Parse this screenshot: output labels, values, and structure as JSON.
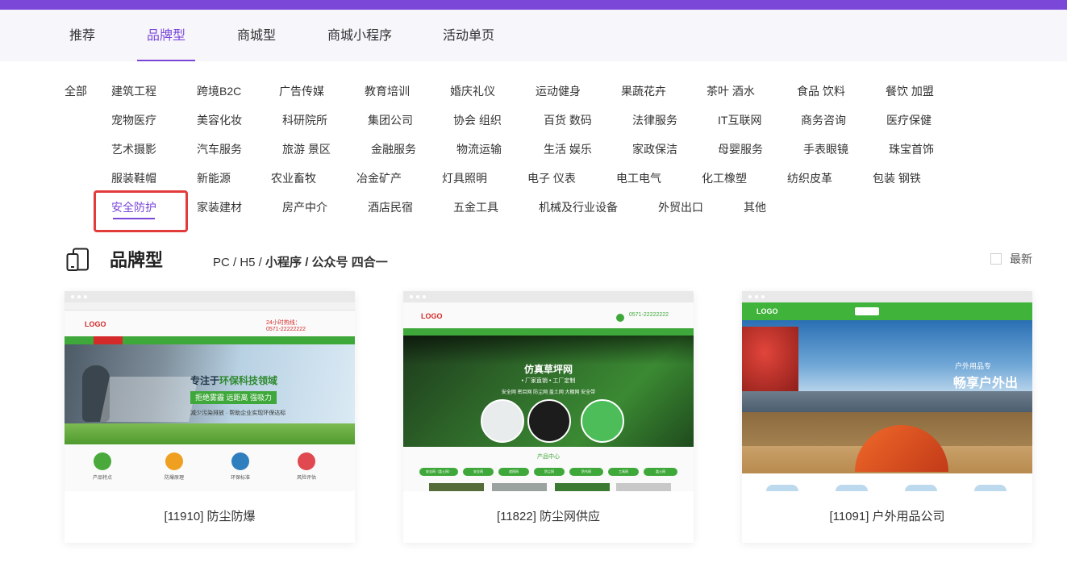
{
  "tabs": [
    {
      "label": "推荐",
      "active": false
    },
    {
      "label": "品牌型",
      "active": true
    },
    {
      "label": "商城型",
      "active": false
    },
    {
      "label": "商城小程序",
      "active": false
    },
    {
      "label": "活动单页",
      "active": false
    }
  ],
  "categories": {
    "all_label": "全部",
    "rows": [
      [
        "建筑工程",
        "跨境B2C",
        "广告传媒",
        "教育培训",
        "婚庆礼仪",
        "运动健身",
        "果蔬花卉",
        "茶叶 酒水",
        "食品 饮料",
        "餐饮 加盟"
      ],
      [
        "宠物医疗",
        "美容化妆",
        "科研院所",
        "集团公司",
        "协会 组织",
        "百货 数码",
        "法律服务",
        "IT互联网",
        "商务咨询",
        "医疗保健"
      ],
      [
        "艺术摄影",
        "汽车服务",
        "旅游 景区",
        "金融服务",
        "物流运输",
        "生活 娱乐",
        "家政保洁",
        "母婴服务",
        "手表眼镜",
        "珠宝首饰"
      ],
      [
        "服装鞋帽",
        "新能源",
        "农业畜牧",
        "冶金矿产",
        "灯具照明",
        "电子 仪表",
        "电工电气",
        "化工橡塑",
        "纺织皮革",
        "包装 钢铁"
      ],
      [
        "安全防护",
        "家装建材",
        "房产中介",
        "酒店民宿",
        "五金工具",
        "机械及行业设备",
        "外贸出口",
        "其他"
      ]
    ],
    "active": "安全防护"
  },
  "section": {
    "title": "品牌型",
    "sub_plain": "PC / H5 / ",
    "sub_bold": "小程序 / 公众号 四合一",
    "newest_label": "最新",
    "newest_checked": false
  },
  "cards": [
    {
      "caption": "[11910] 防尘防爆",
      "logo": "LOGO",
      "hotline": "24小时热线：",
      "phone": "0571-22222222",
      "headline": "专注于",
      "headline_em": "环保科技领域",
      "banner_box": "拒绝雾霾 远距离 强吸力",
      "banner_line": "减少污染排放 · 帮助企业实现环保达标",
      "feature_labels": [
        "产品特点",
        "防爆原理",
        "环保标准",
        "风险评估"
      ]
    },
    {
      "caption": "[11822] 防尘网供应",
      "logo": "LOGO",
      "phone": "0571-22222222",
      "banner_title": "仿真草坪网",
      "banner_sub": "• 厂家直销 • 工厂定制",
      "banner_tags": "安全网 密目网 防尘网 盖土网 大棚网 安全带",
      "section_label": "产品中心",
      "pills": [
        "安全网（盖土网）",
        "安全网",
        "遮阳网",
        "防尘网",
        "防鸟网",
        "工具网",
        "盖土网"
      ]
    },
    {
      "caption": "[11091] 户外用品公司",
      "logo": "LOGO",
      "banner_small": "户外用品专",
      "banner_big": "畅享户外出"
    }
  ],
  "colors": {
    "accent": "#7a47d8",
    "highlight": "#e23b3b",
    "green": "#3fa83a"
  }
}
